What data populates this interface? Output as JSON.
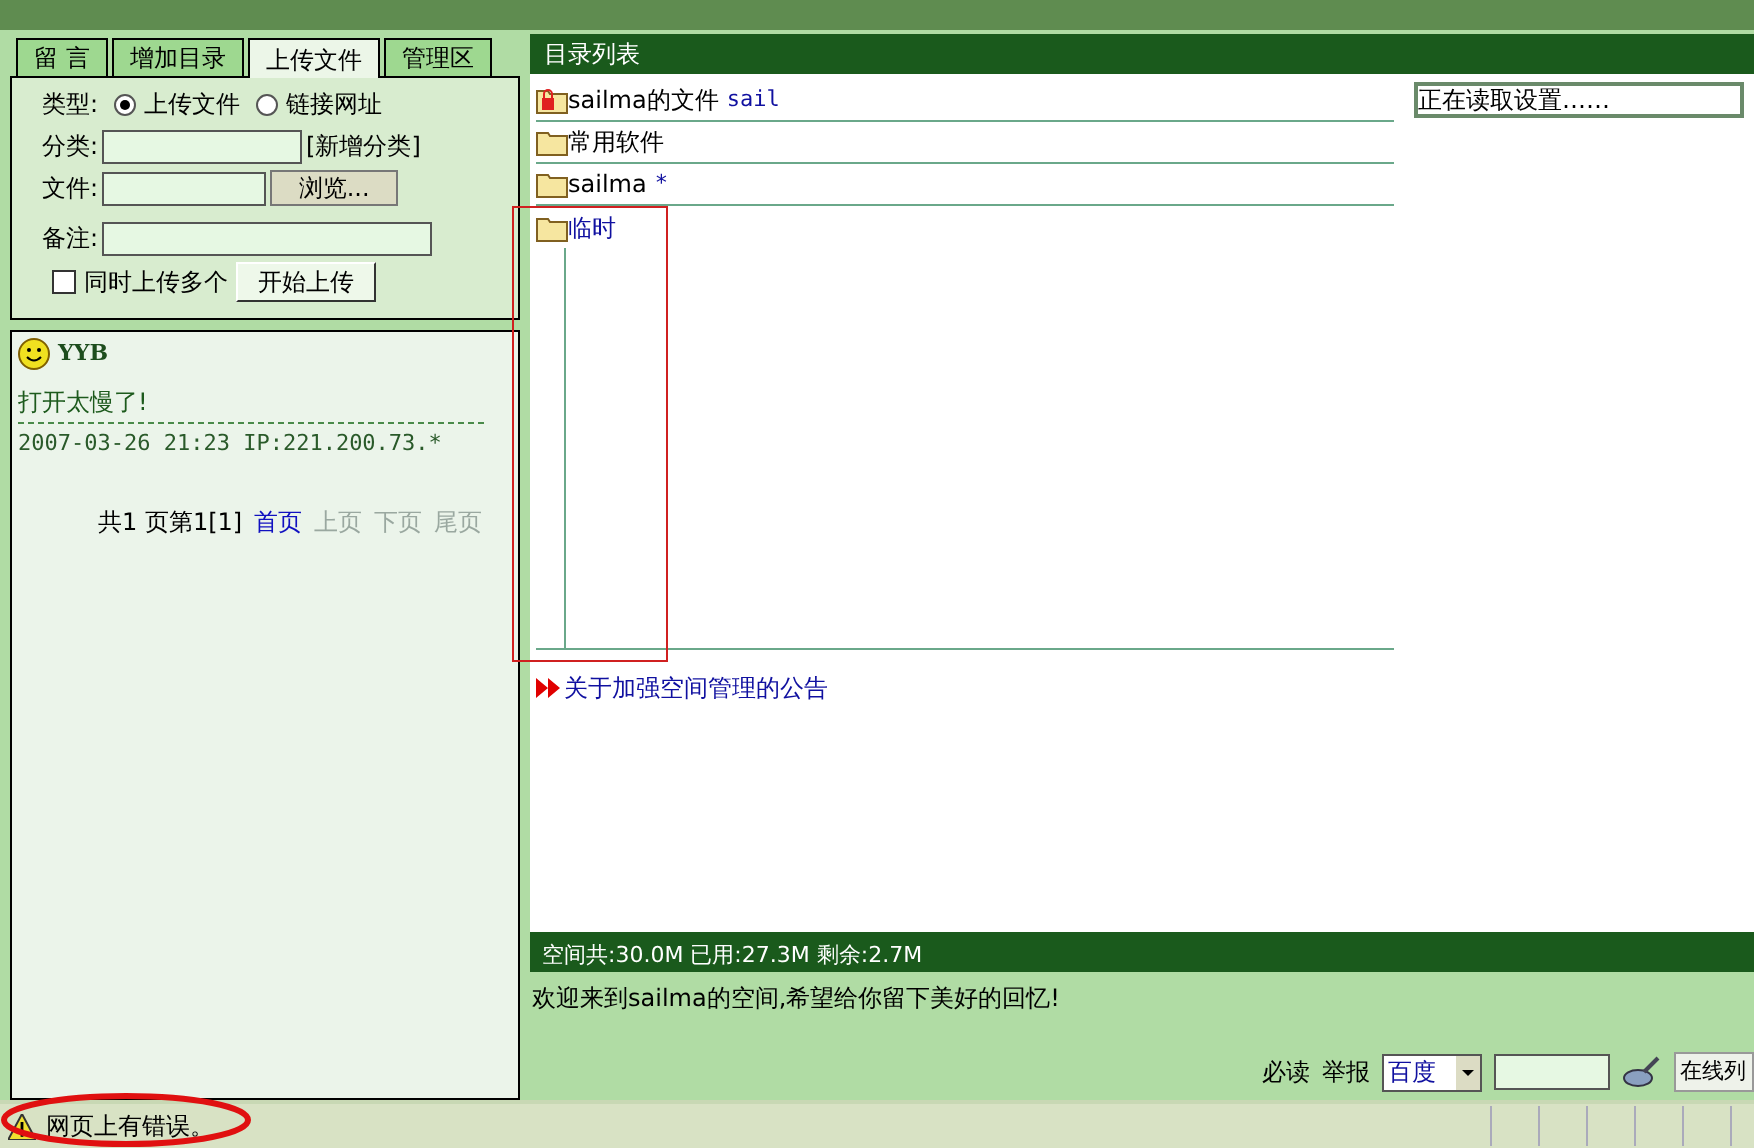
{
  "tabs": [
    {
      "label": "留 言",
      "selected": false
    },
    {
      "label": "增加目录",
      "selected": false
    },
    {
      "label": "上传文件",
      "selected": true
    },
    {
      "label": "管理区",
      "selected": false
    }
  ],
  "upload": {
    "type_label": "类型:",
    "type_options": [
      {
        "label": "上传文件",
        "selected": true
      },
      {
        "label": "链接网址",
        "selected": false
      }
    ],
    "category_label": "分类:",
    "new_category": "[新增分类]",
    "file_label": "文件:",
    "browse": "浏览...",
    "note_label": "备注:",
    "multi": {
      "label": "同时上传多个",
      "checked": false
    },
    "submit": "开始上传"
  },
  "guestbook": {
    "author": "YYB",
    "message": "打开太慢了!",
    "meta": "2007-03-26 21:23 IP:221.200.73.*",
    "pager": [
      {
        "label": "共1 页第1[1]",
        "kind": "text"
      },
      {
        "label": "首页",
        "kind": "link"
      },
      {
        "label": "上页",
        "kind": "disabled"
      },
      {
        "label": "下页",
        "kind": "disabled"
      },
      {
        "label": "尾页",
        "kind": "disabled"
      }
    ]
  },
  "directory": {
    "title": "目录列表",
    "items": [
      {
        "name": "sailma的文件",
        "note": "sail",
        "kind": "locked"
      },
      {
        "name": "常用软件",
        "kind": "folder"
      },
      {
        "name": "sailma",
        "note": "*",
        "kind": "folder"
      },
      {
        "name": "临时",
        "kind": "open"
      }
    ],
    "settings_status": "正在读取设置……",
    "notice": "关于加强空间管理的公告",
    "space": "空间共:30.0M 已用:27.3M 剩余:2.7M"
  },
  "welcome": "欢迎来到sailma的空间,希望给你留下美好的回忆!",
  "footer": {
    "links": [
      "必读",
      "举报"
    ],
    "search_engine": "百度",
    "online": "在线列"
  },
  "status_bar": {
    "message": "网页上有错误。"
  }
}
